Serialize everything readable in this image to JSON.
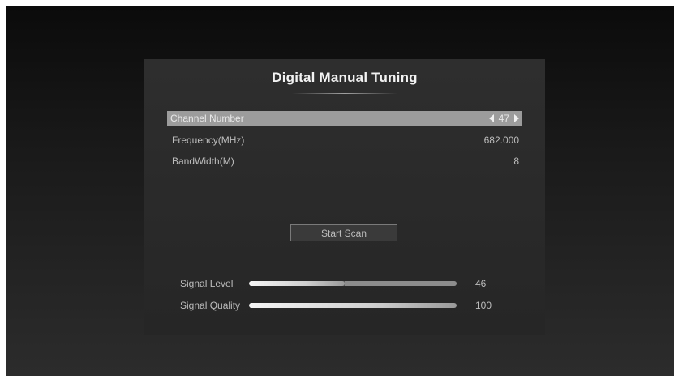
{
  "dialog": {
    "title": "Digital Manual Tuning"
  },
  "rows": [
    {
      "label": "Channel Number",
      "value": "47"
    },
    {
      "label": "Frequency(MHz)",
      "value": "682.000"
    },
    {
      "label": "BandWidth(M)",
      "value": "8"
    }
  ],
  "scan_button": {
    "label": "Start Scan"
  },
  "signal": {
    "level_label": "Signal Level",
    "level_value": "46",
    "level_fraction": 0.46,
    "quality_label": "Signal Quality",
    "quality_value": "100",
    "quality_fraction": 1.0
  },
  "colors": {
    "selected_row": "#9c9c9c",
    "panel": "#2b2b2b",
    "text": "#bdbdbd"
  },
  "icons": {
    "prev": "left-arrow-icon",
    "next": "right-arrow-icon"
  }
}
